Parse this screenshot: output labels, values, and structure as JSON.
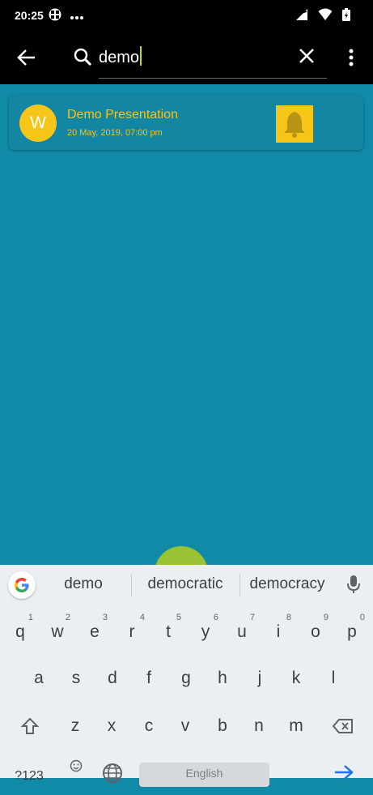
{
  "status": {
    "time": "20:25"
  },
  "search": {
    "query": "demo"
  },
  "results": [
    {
      "avatar_letter": "W",
      "title": "Demo Presentation",
      "datetime": "20 May, 2019, 07:00 pm",
      "icon": "bell-icon"
    }
  ],
  "keyboard": {
    "suggestions": [
      "demo",
      "democratic",
      "democracy"
    ],
    "row1": [
      {
        "k": "q",
        "h": "1"
      },
      {
        "k": "w",
        "h": "2"
      },
      {
        "k": "e",
        "h": "3"
      },
      {
        "k": "r",
        "h": "4"
      },
      {
        "k": "t",
        "h": "5"
      },
      {
        "k": "y",
        "h": "6"
      },
      {
        "k": "u",
        "h": "7"
      },
      {
        "k": "i",
        "h": "8"
      },
      {
        "k": "o",
        "h": "9"
      },
      {
        "k": "p",
        "h": "0"
      }
    ],
    "row2": [
      "a",
      "s",
      "d",
      "f",
      "g",
      "h",
      "j",
      "k",
      "l"
    ],
    "row3": [
      "z",
      "x",
      "c",
      "v",
      "b",
      "n",
      "m"
    ],
    "symbols_label": "?123",
    "space_label": "English"
  },
  "colors": {
    "background": "#118aa8",
    "accent_yellow": "#f5c518",
    "fab_green": "#9ac334",
    "toolbar": "#000000"
  }
}
